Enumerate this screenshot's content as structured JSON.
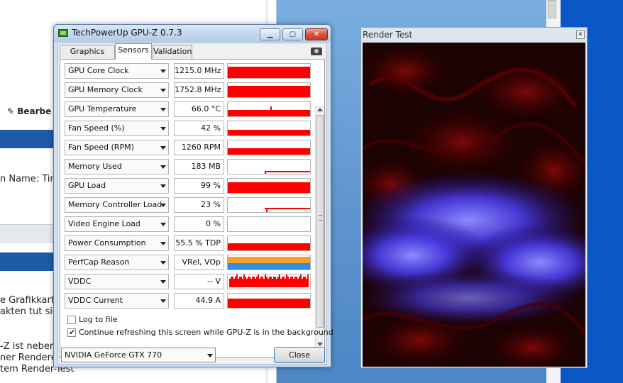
{
  "browser": {
    "edit_label": "Bearbe",
    "text_name": "n Name: Tim",
    "text_lines_1": [
      "e Grafikkarte",
      "akten tut sie"
    ],
    "text_lines_2": [
      "-Z ist neber",
      "ner Rendere",
      "tem Render-Test"
    ]
  },
  "gpuz": {
    "title": "TechPowerUp GPU-Z 0.7.3",
    "tabs": [
      "Graphics Card",
      "Sensors",
      "Validation"
    ],
    "sensors": [
      {
        "name": "GPU Core Clock",
        "value": "1215.0 MHz"
      },
      {
        "name": "GPU Memory Clock",
        "value": "1752.8 MHz"
      },
      {
        "name": "GPU Temperature",
        "value": "66.0 °C"
      },
      {
        "name": "Fan Speed (%)",
        "value": "42 %"
      },
      {
        "name": "Fan Speed (RPM)",
        "value": "1260 RPM"
      },
      {
        "name": "Memory Used",
        "value": "183 MB"
      },
      {
        "name": "GPU Load",
        "value": "99 %"
      },
      {
        "name": "Memory Controller Load",
        "value": "23 %"
      },
      {
        "name": "Video Engine Load",
        "value": "0 %"
      },
      {
        "name": "Power Consumption",
        "value": "55.5 % TDP"
      },
      {
        "name": "PerfCap Reason",
        "value": "VRel, VOp"
      },
      {
        "name": "VDDC",
        "value": "-- V"
      },
      {
        "name": "VDDC Current",
        "value": "44.9 A"
      }
    ],
    "log_to_file": "Log to file",
    "continue_refreshing": "Continue refreshing this screen while GPU-Z is in the background",
    "gpu_select": "NVIDIA GeForce GTX 770",
    "close_label": "Close"
  },
  "render": {
    "title": "Render Test"
  }
}
